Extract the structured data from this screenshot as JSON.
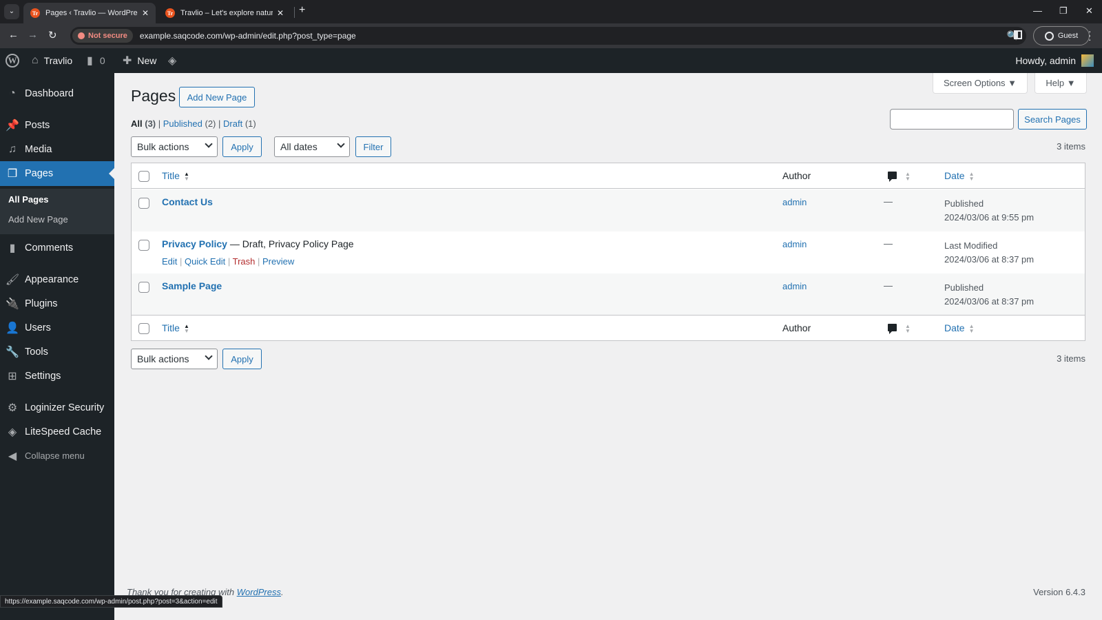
{
  "browser": {
    "tabs": [
      {
        "title": "Pages ‹ Travlio — WordPress",
        "favicon": "Tr",
        "active": true
      },
      {
        "title": "Travlio – Let's explore natural vi",
        "favicon": "Tr",
        "active": false
      }
    ],
    "security_label": "Not secure",
    "url": "example.saqcode.com/wp-admin/edit.php?post_type=page",
    "profile_label": "Guest",
    "status_url": "https://example.saqcode.com/wp-admin/post.php?post=3&action=edit"
  },
  "adminbar": {
    "site_name": "Travlio",
    "comments_count": "0",
    "new_label": "New",
    "greeting": "Howdy, admin"
  },
  "sidebar": {
    "items": [
      {
        "label": "Dashboard",
        "icon": "dashboard-icon"
      },
      {
        "label": "Posts",
        "icon": "pin-icon"
      },
      {
        "label": "Media",
        "icon": "media-icon"
      },
      {
        "label": "Pages",
        "icon": "pages-icon",
        "current": true
      },
      {
        "label": "Comments",
        "icon": "comment-icon"
      },
      {
        "label": "Appearance",
        "icon": "brush-icon"
      },
      {
        "label": "Plugins",
        "icon": "plug-icon"
      },
      {
        "label": "Users",
        "icon": "user-icon"
      },
      {
        "label": "Tools",
        "icon": "wrench-icon"
      },
      {
        "label": "Settings",
        "icon": "settings-icon"
      },
      {
        "label": "Loginizer Security",
        "icon": "gear-icon"
      },
      {
        "label": "LiteSpeed Cache",
        "icon": "diamond-icon"
      }
    ],
    "submenu": [
      "All Pages",
      "Add New Page"
    ],
    "collapse_label": "Collapse menu"
  },
  "main": {
    "screen_options": "Screen Options ▼",
    "help": "Help ▼",
    "title": "Pages",
    "add_new": "Add New Page",
    "filters": {
      "all": "All",
      "all_count": "(3)",
      "published": "Published",
      "published_count": "(2)",
      "draft": "Draft",
      "draft_count": "(1)"
    },
    "search_value": "",
    "search_button": "Search Pages",
    "bulk_actions": "Bulk actions",
    "apply": "Apply",
    "dates": "All dates",
    "filter": "Filter",
    "items_count": "3 items",
    "columns": {
      "title": "Title",
      "author": "Author",
      "date": "Date"
    },
    "rows": [
      {
        "title": "Contact Us",
        "state": "",
        "author": "admin",
        "comments": "—",
        "status": "Published",
        "date": "2024/03/06 at 9:55 pm"
      },
      {
        "title": "Privacy Policy",
        "state": " — Draft, Privacy Policy Page",
        "author": "admin",
        "comments": "—",
        "status": "Last Modified",
        "date": "2024/03/06 at 8:37 pm"
      },
      {
        "title": "Sample Page",
        "state": "",
        "author": "admin",
        "comments": "—",
        "status": "Published",
        "date": "2024/03/06 at 8:37 pm"
      }
    ],
    "row_actions": {
      "edit": "Edit",
      "quick_edit": "Quick Edit",
      "trash": "Trash",
      "preview": "Preview"
    }
  },
  "footer": {
    "thanks": "Thank you for creating with ",
    "wp_link": "WordPress",
    "version": "Version 6.4.3"
  }
}
